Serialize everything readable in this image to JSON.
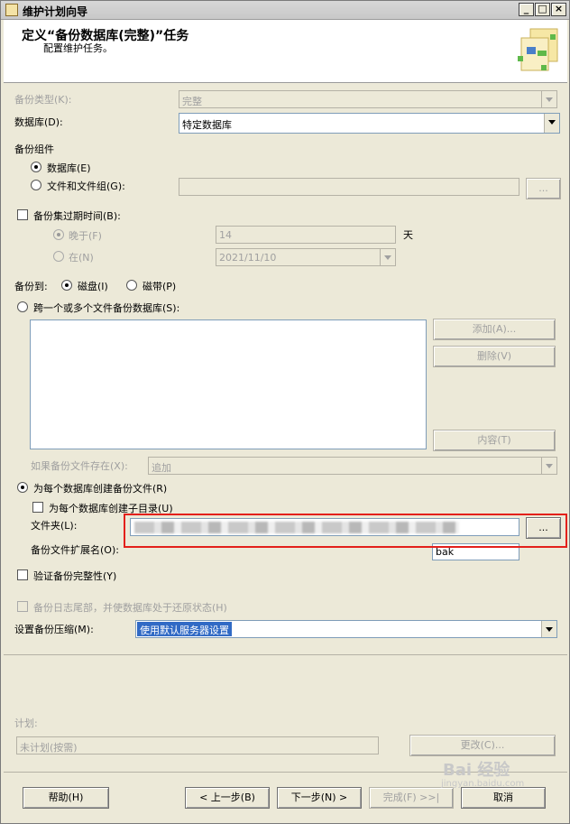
{
  "window": {
    "title": "维护计划向导",
    "controls": {
      "minimize": "_",
      "maximize": "□",
      "close": "×"
    }
  },
  "header": {
    "title": "定义“备份数据库(完整)”任务",
    "subtitle": "配置维护任务。",
    "image_icon": "wizard-graphic-icon"
  },
  "form": {
    "backup_type": {
      "label": "备份类型(K):",
      "value": "完整"
    },
    "database": {
      "label": "数据库(D):",
      "value": "特定数据库"
    },
    "backup_component": {
      "label": "备份组件",
      "database_option": "数据库(E)",
      "files_option": "文件和文件组(G):",
      "browse": "..."
    },
    "expire": {
      "label": "备份集过期时间(B):",
      "after_option": "晚于(F)",
      "after_value": "14",
      "after_unit": "天",
      "on_option": "在(N)",
      "on_value": "2021/11/10"
    },
    "backup_to": {
      "label": "备份到:",
      "disk": "磁盘(I)",
      "tape": "磁带(P)"
    },
    "span_files": {
      "label": "跨一个或多个文件备份数据库(S):",
      "add": "添加(A)...",
      "remove": "删除(V)",
      "contents": "内容(T)"
    },
    "if_exists": {
      "label": "如果备份文件存在(X):",
      "value": "追加"
    },
    "per_db": {
      "label": "为每个数据库创建备份文件(R)",
      "subdir": "为每个数据库创建子目录(U)",
      "folder_label": "文件夹(L):",
      "folder_browse": "...",
      "ext_label": "备份文件扩展名(O):",
      "ext_value": "bak"
    },
    "verify": {
      "label": "验证备份完整性(Y)"
    },
    "tail_log": {
      "label": "备份日志尾部，并使数据库处于还原状态(H)"
    },
    "compression": {
      "label": "设置备份压缩(M):",
      "value": "使用默认服务器设置"
    },
    "schedule": {
      "label": "计划:",
      "value": "未计划(按需)",
      "change": "更改(C)..."
    }
  },
  "footer": {
    "help": "帮助(H)",
    "back": "< 上一步(B)",
    "next": "下一步(N) >",
    "finish": "完成(F) >>|",
    "cancel": "取消"
  },
  "watermark": {
    "text": "Bai 经验",
    "sub": "jingyan.baidu.com"
  },
  "colors": {
    "highlight": "#e3201b",
    "selection": "#316ac5"
  }
}
